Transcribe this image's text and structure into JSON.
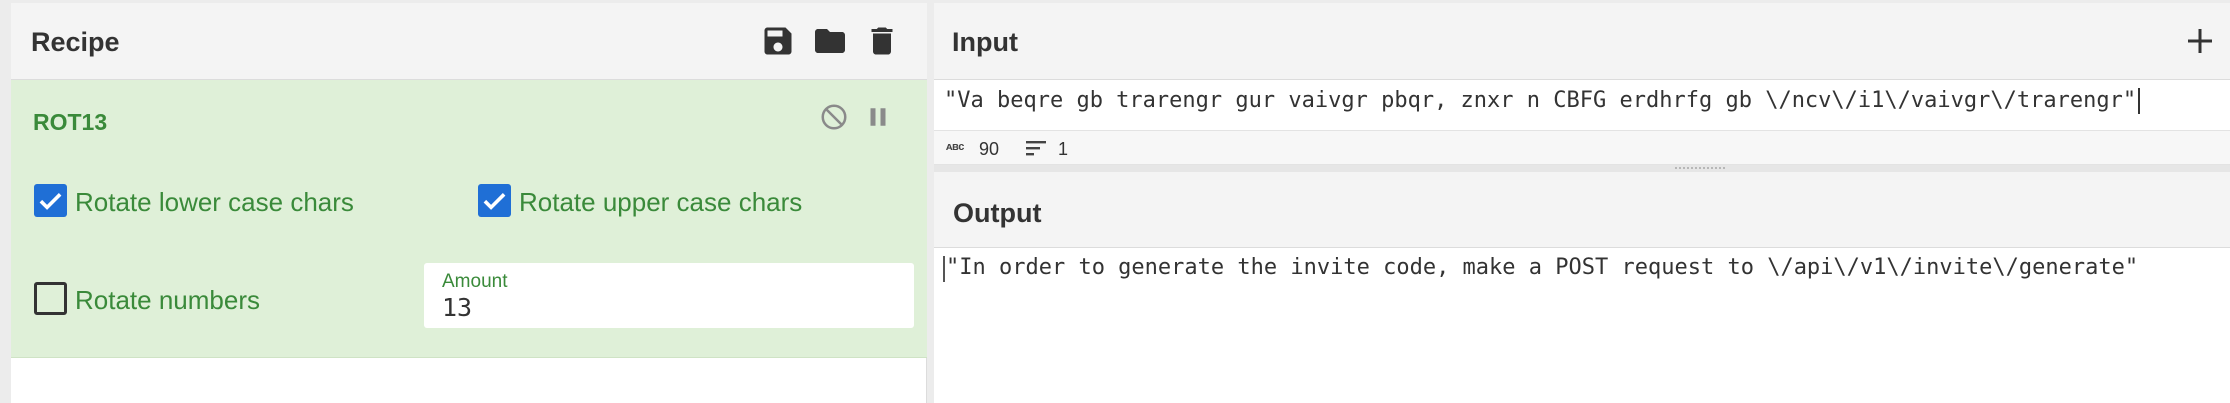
{
  "recipe": {
    "title": "Recipe",
    "icons": [
      "save-icon",
      "folder-icon",
      "trash-icon"
    ],
    "operation": {
      "name": "ROT13",
      "controls": [
        "disable-icon",
        "pause-icon"
      ],
      "options": {
        "rotate_lower": {
          "label": "Rotate lower case chars",
          "checked": true
        },
        "rotate_upper": {
          "label": "Rotate upper case chars",
          "checked": true
        },
        "rotate_numbers": {
          "label": "Rotate numbers",
          "checked": false
        }
      },
      "amount": {
        "label": "Amount",
        "value": "13"
      }
    }
  },
  "input": {
    "title": "Input",
    "text": "\"Va beqre gb trarengr gur vaivgr pbqr, znxr n CBFG erdhrfg gb \\/ncv\\/i1\\/vaivgr\\/trarengr\"",
    "stats": {
      "length_icon": "ᴀʙᴄ",
      "length": "90",
      "lines": "1"
    }
  },
  "output": {
    "title": "Output",
    "text": "\"In order to generate the invite code, make a POST request to \\/api\\/v1\\/invite\\/generate\""
  },
  "colors": {
    "operation_bg": "#dff0d8",
    "operation_text": "#3a8a3a",
    "checkbox": "#1f6fd6"
  }
}
